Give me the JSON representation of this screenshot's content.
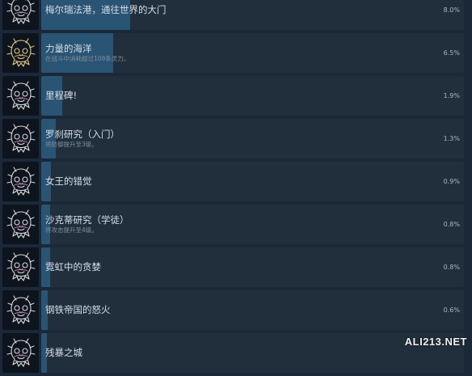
{
  "achievements": [
    {
      "name": "梅尔瑞法港，通往世界的大门",
      "desc": "",
      "percent": "8.0%",
      "value": 8.0,
      "icon_color": "#d8d8d8",
      "accent": "#b38aa8"
    },
    {
      "name": "力量的海洋",
      "desc": "在战斗中消耗超过108条灵力。",
      "percent": "6.5%",
      "value": 6.5,
      "icon_color": "#e2c889",
      "accent": "#d6a860"
    },
    {
      "name": "里程碑!",
      "desc": "",
      "percent": "1.9%",
      "value": 1.9,
      "icon_color": "#d8d8d8",
      "accent": "#c07aa8"
    },
    {
      "name": "罗刹研究（入门）",
      "desc": "将防御提升至3级。",
      "percent": "1.3%",
      "value": 1.3,
      "icon_color": "#d8d8d8",
      "accent": "#c07aa8"
    },
    {
      "name": "女王的错觉",
      "desc": "",
      "percent": "0.9%",
      "value": 0.9,
      "icon_color": "#d8d8d8",
      "accent": "#c07aa8"
    },
    {
      "name": "沙克蒂研究（学徒）",
      "desc": "将攻击提升至4级。",
      "percent": "0.8%",
      "value": 0.8,
      "icon_color": "#d8d8d8",
      "accent": "#c07aa8"
    },
    {
      "name": "霓虹中的贪婪",
      "desc": "",
      "percent": "0.8%",
      "value": 0.8,
      "icon_color": "#d8d8d8",
      "accent": "#c07aa8"
    },
    {
      "name": "钢铁帝国的怒火",
      "desc": "",
      "percent": "0.6%",
      "value": 0.6,
      "icon_color": "#d8d8d8",
      "accent": "#c07aa8"
    },
    {
      "name": "残暴之城",
      "desc": "",
      "percent": "",
      "value": 0.5,
      "icon_color": "#d8d8d8",
      "accent": "#c07aa8"
    }
  ],
  "watermark": "ALI213.NET",
  "fill_scale_max": 8.0
}
